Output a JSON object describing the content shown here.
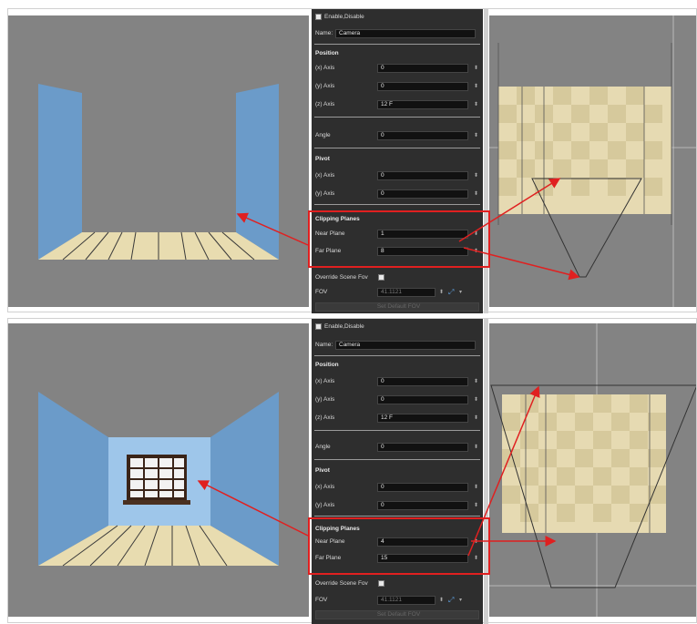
{
  "colors": {
    "viewport_bg": "#838383",
    "panel_bg": "#2e2e2e",
    "wall_blue": "#6b9bc9",
    "floor_tile": "#e8dcb0",
    "highlight_red": "#e02020"
  },
  "panels": [
    {
      "enable_label": "Enable,Disable",
      "name_label": "Name:",
      "name_value": "Camera",
      "position_heading": "Position",
      "x_axis_label": "(x) Axis",
      "x_axis_value": "0",
      "y_axis_label": "(y) Axis",
      "y_axis_value": "0",
      "z_axis_label": "(z) Axis",
      "z_axis_value": "12 F",
      "angle_label": "Angle",
      "angle_value": "0",
      "pivot_heading": "Pivot",
      "pivot_x_label": "(x) Axis",
      "pivot_x_value": "0",
      "pivot_y_label": "(y) Axis",
      "pivot_y_value": "0",
      "clipping_heading": "Clipping Planes",
      "near_label": "Near Plane",
      "near_value": "1",
      "far_label": "Far Plane",
      "far_value": "8",
      "override_label": "Override Scene Fov",
      "fov_label": "FOV",
      "fov_value": "41.1121",
      "default_fov_label": "Set Default FOV"
    },
    {
      "enable_label": "Enable,Disable",
      "name_label": "Name:",
      "name_value": "Camera",
      "position_heading": "Position",
      "x_axis_label": "(x) Axis",
      "x_axis_value": "0",
      "y_axis_label": "(y) Axis",
      "y_axis_value": "0",
      "z_axis_label": "(z) Axis",
      "z_axis_value": "12 F",
      "angle_label": "Angle",
      "angle_value": "0",
      "pivot_heading": "Pivot",
      "pivot_x_label": "(x) Axis",
      "pivot_x_value": "0",
      "pivot_y_label": "(y) Axis",
      "pivot_y_value": "0",
      "clipping_heading": "Clipping Planes",
      "near_label": "Near Plane",
      "near_value": "4",
      "far_label": "Far Plane",
      "far_value": "15",
      "override_label": "Override Scene Fov",
      "fov_label": "FOV",
      "fov_value": "41.1121",
      "default_fov_label": "Set Default FOV"
    }
  ]
}
